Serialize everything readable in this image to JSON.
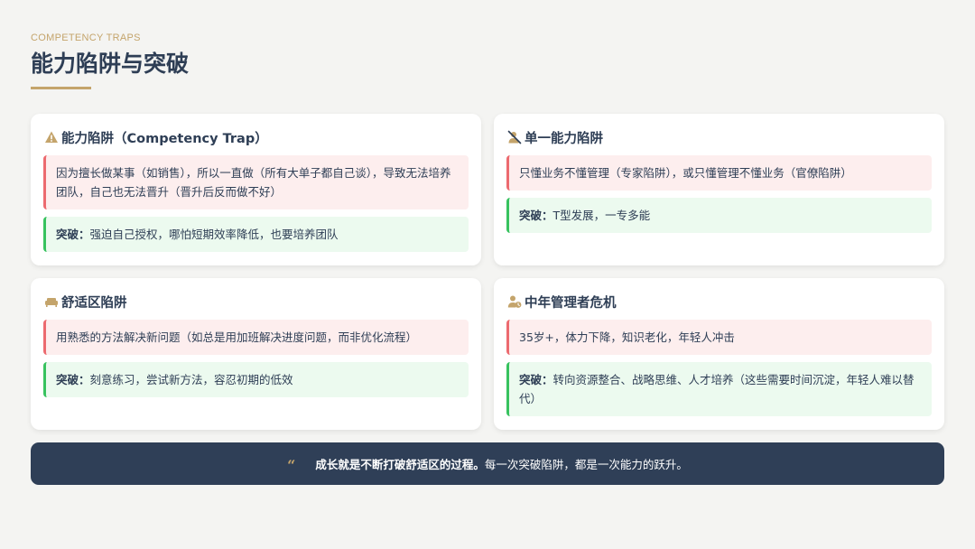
{
  "header": {
    "eyebrow": "COMPETENCY TRAPS",
    "title": "能力陷阱与突破"
  },
  "colors": {
    "accent_gold": "#c4a46b",
    "navy": "#2f3f57",
    "problem_border": "#ec6a6f",
    "solution_border": "#37c25e"
  },
  "cards": [
    {
      "icon": "warning-icon",
      "title": "能力陷阱（Competency Trap）",
      "problem": "因为擅长做某事（如销售），所以一直做（所有大单子都自己谈），导致无法培养团队，自己也无法晋升（晋升后反而做不好）",
      "solution_label": "突破：",
      "solution": "强迫自己授权，哪怕短期效率降低，也要培养团队"
    },
    {
      "icon": "user-slash-icon",
      "title": "单一能力陷阱",
      "problem": "只懂业务不懂管理（专家陷阱），或只懂管理不懂业务（官僚陷阱）",
      "solution_label": "突破：",
      "solution": "T型发展，一专多能"
    },
    {
      "icon": "couch-icon",
      "title": "舒适区陷阱",
      "problem": "用熟悉的方法解决新问题（如总是用加班解决进度问题，而非优化流程）",
      "solution_label": "突破：",
      "solution": "刻意练习，尝试新方法，容忍初期的低效"
    },
    {
      "icon": "user-clock-icon",
      "title": "中年管理者危机",
      "problem": "35岁+，体力下降，知识老化，年轻人冲击",
      "solution_label": "突破：",
      "solution": "转向资源整合、战略思维、人才培养（这些需要时间沉淀，年轻人难以替代）"
    }
  ],
  "banner": {
    "quote_mark": "“",
    "bold": "成长就是不断打破舒适区的过程。",
    "text": "每一次突破陷阱，都是一次能力的跃升。"
  }
}
